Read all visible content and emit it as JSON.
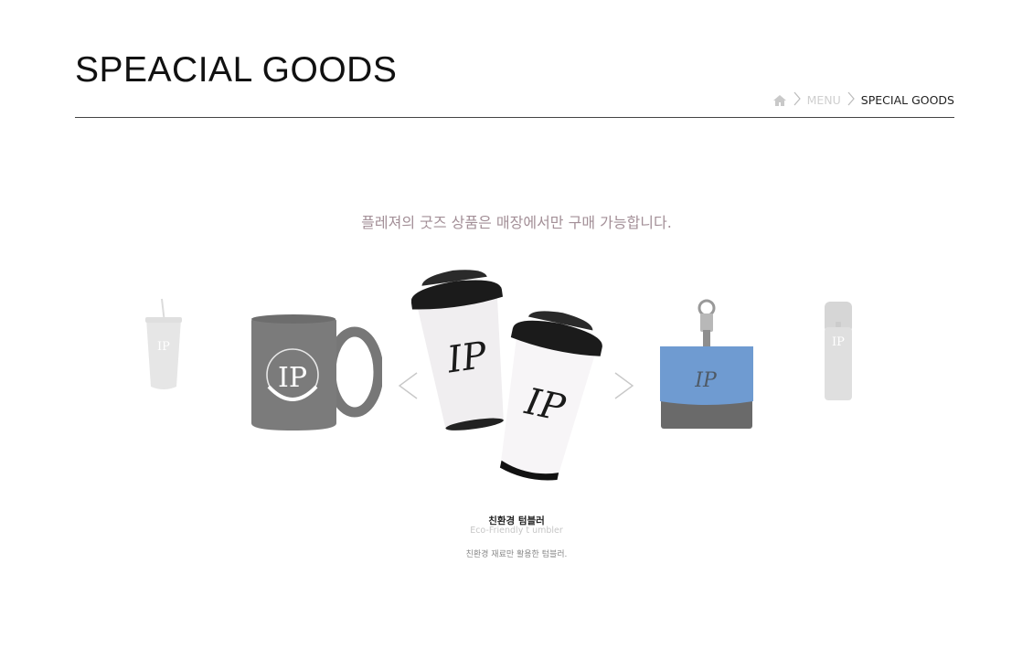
{
  "header": {
    "title": "SPEACIAL GOODS",
    "breadcrumb": {
      "home_icon": "home-icon",
      "items": [
        "MENU",
        "SPECIAL GOODS"
      ]
    }
  },
  "notice": "플레져의 굿즈 상품은 매장에서만 구매 가능합니다.",
  "carousel": {
    "prev_icon": "chevron-left-icon",
    "next_icon": "chevron-right-icon",
    "slides": [
      {
        "name": "tumbler-cup",
        "state": "faded"
      },
      {
        "name": "mug",
        "state": "dim"
      },
      {
        "name": "eco-tumbler-pair",
        "state": "active"
      },
      {
        "name": "pouch",
        "state": "dim"
      },
      {
        "name": "thermos-bottle",
        "state": "faded"
      }
    ],
    "active": {
      "name_ko": "친환경 텀블러",
      "name_en": "Eco-Friendly t umbler",
      "description": "친환경 재료만 활용한 텀블러."
    }
  },
  "colors": {
    "title": "#111111",
    "notice": "#a38f97",
    "rule": "#444444",
    "pouch_blue": "#6f9bd1"
  }
}
